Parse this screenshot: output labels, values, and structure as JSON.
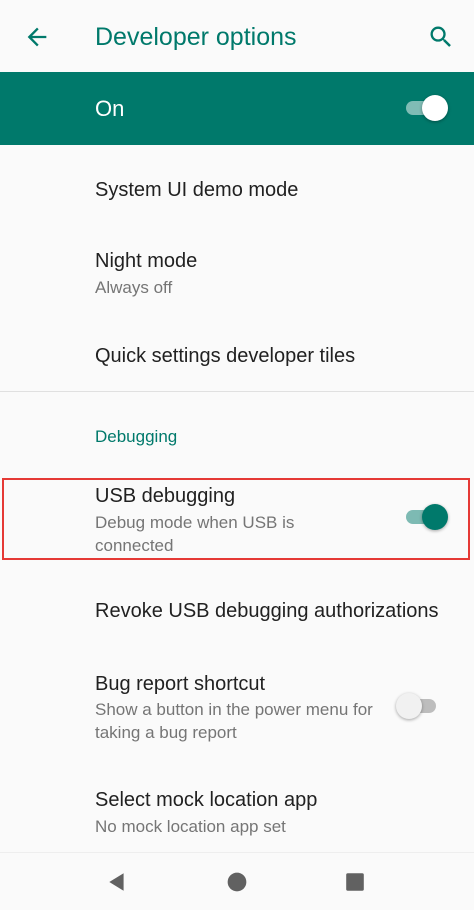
{
  "appbar": {
    "title": "Developer options",
    "back_icon": "arrow-back-icon",
    "search_icon": "search-icon"
  },
  "master_switch": {
    "label": "On",
    "checked": true
  },
  "items": [
    {
      "title": "System UI demo mode",
      "summary": ""
    },
    {
      "title": "Night mode",
      "summary": "Always off"
    },
    {
      "title": "Quick settings developer tiles",
      "summary": ""
    }
  ],
  "debugging": {
    "category_label": "Debugging",
    "usb_debugging": {
      "title": "USB debugging",
      "summary": "Debug mode when USB is connected",
      "checked": true
    },
    "revoke": {
      "title": "Revoke USB debugging authorizations"
    },
    "bug_report": {
      "title": "Bug report shortcut",
      "summary": "Show a button in the power menu for taking a bug report",
      "checked": false
    },
    "mock_location": {
      "title": "Select mock location app",
      "summary": "No mock location app set"
    }
  },
  "navbar": {
    "back_icon": "nav-back-triangle-icon",
    "home_icon": "nav-home-circle-icon",
    "recents_icon": "nav-recents-square-icon"
  },
  "colors": {
    "accent": "#00796b",
    "highlight_border": "#e53935",
    "text_primary": "#212121",
    "text_secondary": "#757575"
  }
}
